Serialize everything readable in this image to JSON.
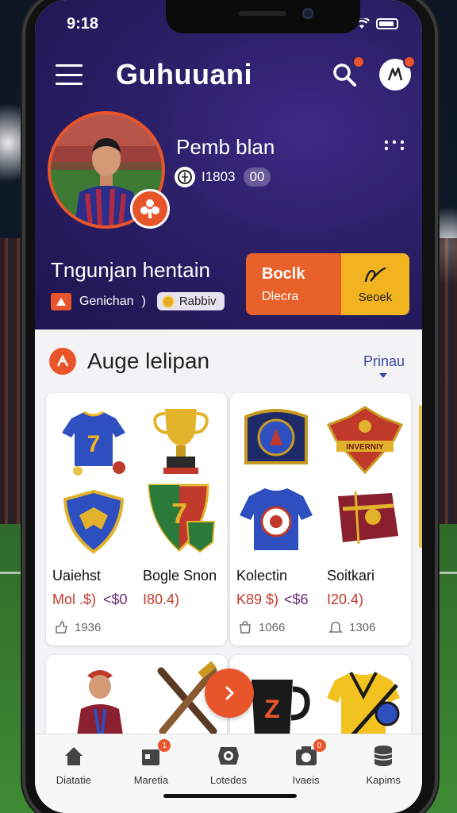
{
  "status": {
    "time": "9:18"
  },
  "app": {
    "title": "Guhuuani"
  },
  "profile": {
    "name": "Pemb blan",
    "stat_value": "I1803",
    "stat_pill": "00",
    "subtitle": "Tngunjan hentain",
    "tag_label": "Genichan",
    "tag_pill": "Rabbiv"
  },
  "actions": {
    "primary_line1": "Boclk",
    "primary_line2": "Dlecra",
    "secondary_label": "Seoek"
  },
  "section": {
    "title": "Auge lelipan",
    "link": "Prinau"
  },
  "cards": [
    {
      "items": [
        {
          "name": "Uaiehst",
          "price": "Mol .$)",
          "meta": "1936"
        },
        {
          "name": "Bogle Snon",
          "price": "I80.4)",
          "meta": ""
        }
      ],
      "price_extra": "<$0",
      "icons": [
        "jersey-icon",
        "trophy-icon",
        "shield-icon",
        "badge-icon"
      ]
    },
    {
      "items": [
        {
          "name": "Kolectin",
          "price": "K89 $)",
          "meta": "1066"
        },
        {
          "name": "Soitkari",
          "price": "I20.4)",
          "meta": "1306"
        }
      ],
      "price_extra": "<$6",
      "icons": [
        "crest-icon",
        "emblem-icon",
        "shirt-icon",
        "scarf-icon"
      ]
    }
  ],
  "nav": [
    {
      "label": "Diatatie",
      "icon": "home-icon",
      "badge": ""
    },
    {
      "label": "Maretia",
      "icon": "store-icon",
      "badge": "1"
    },
    {
      "label": "Lotedes",
      "icon": "camera-icon",
      "badge": ""
    },
    {
      "label": "Ivaeis",
      "icon": "photo-icon",
      "badge": "0"
    },
    {
      "label": "Kapims",
      "icon": "coins-icon",
      "badge": ""
    }
  ],
  "colors": {
    "accent": "#e8552a",
    "hero_bg": "#2b1f66",
    "yellow": "#f2b320",
    "link": "#3d4aa6"
  }
}
